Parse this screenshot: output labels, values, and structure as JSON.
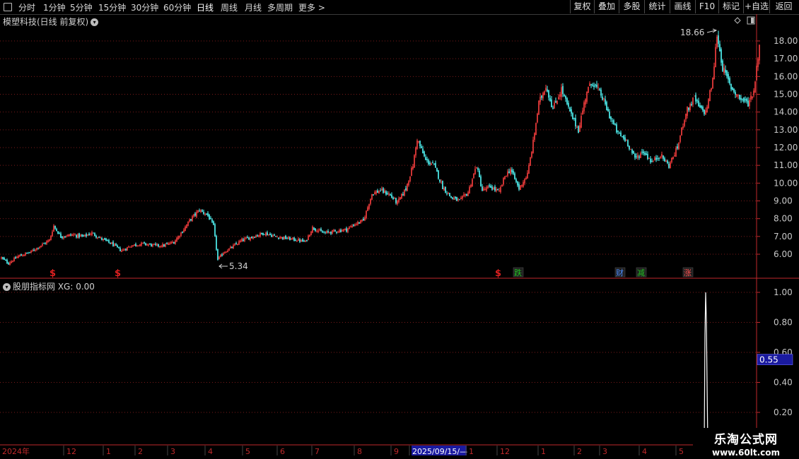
{
  "toolbar": {
    "left_items": [
      "分时",
      "1分钟",
      "5分钟",
      "15分钟",
      "30分钟",
      "60分钟",
      "日线",
      "周线",
      "月线",
      "多周期",
      "更多 >"
    ],
    "active_item": "日线",
    "right_items": [
      "复权",
      "叠加",
      "多股",
      "统计",
      "画线",
      "F10",
      "标记",
      "+自选",
      "返回"
    ]
  },
  "main_panel": {
    "title": "模塑科技(日线 前复权)",
    "high_label": "18.66",
    "low_label": "5.34"
  },
  "sub_panel": {
    "title": "股朋指标网  XG: 0.00",
    "current_value_box": "0.55"
  },
  "markers": [
    {
      "text": "$",
      "color": "#e02020",
      "index": 36
    },
    {
      "text": "$",
      "color": "#e02020",
      "index": 82
    },
    {
      "text": "$",
      "color": "#e02020",
      "index": 351
    },
    {
      "text": "跌",
      "color": "#22c022",
      "index": 365
    },
    {
      "text": "财",
      "color": "#4a8cff",
      "index": 437
    },
    {
      "text": "减",
      "color": "#22c022",
      "index": 452
    },
    {
      "text": "涨",
      "color": "#ff5050",
      "index": 485
    }
  ],
  "time_axis": {
    "labels": [
      "2024年",
      "12",
      "1",
      "2",
      "3",
      "4",
      "5",
      "6",
      "7",
      "8",
      "9",
      "2025/09/15/—",
      "1",
      "12",
      "1",
      "2",
      "3",
      "4",
      "5"
    ]
  },
  "watermark": {
    "title": "乐淘公式网",
    "url": "www.60lt.com"
  },
  "colors": {
    "up": "#ff4040",
    "down": "#54ffff",
    "grid": "#7a1a1a",
    "axis": "#c0292b",
    "text": "#c8c8c8"
  },
  "chart_data": [
    {
      "type": "candlestick",
      "title": "模塑科技(日线 前复权)",
      "ylim": [
        5.0,
        19.0
      ],
      "y_ticks": [
        6.0,
        7.0,
        8.0,
        9.0,
        10.0,
        11.0,
        12.0,
        13.0,
        14.0,
        15.0,
        16.0,
        17.0,
        18.0
      ],
      "annotations": [
        {
          "text": "18.66",
          "kind": "high"
        },
        {
          "text": "5.34",
          "kind": "low"
        }
      ],
      "close_path": [
        [
          0,
          5.8
        ],
        [
          5,
          5.5
        ],
        [
          12,
          5.9
        ],
        [
          20,
          6.1
        ],
        [
          28,
          6.5
        ],
        [
          34,
          6.8
        ],
        [
          37,
          7.6
        ],
        [
          42,
          7.0
        ],
        [
          50,
          7.1
        ],
        [
          58,
          7.0
        ],
        [
          64,
          7.2
        ],
        [
          70,
          6.9
        ],
        [
          78,
          6.6
        ],
        [
          85,
          6.2
        ],
        [
          92,
          6.5
        ],
        [
          100,
          6.6
        ],
        [
          108,
          6.5
        ],
        [
          115,
          6.5
        ],
        [
          122,
          6.7
        ],
        [
          128,
          7.3
        ],
        [
          134,
          8.0
        ],
        [
          140,
          8.5
        ],
        [
          146,
          8.2
        ],
        [
          150,
          7.6
        ],
        [
          153,
          5.7
        ],
        [
          157,
          6.1
        ],
        [
          163,
          6.4
        ],
        [
          170,
          6.8
        ],
        [
          178,
          7.0
        ],
        [
          186,
          7.2
        ],
        [
          194,
          7.0
        ],
        [
          202,
          6.9
        ],
        [
          210,
          6.8
        ],
        [
          215,
          6.7
        ],
        [
          220,
          7.5
        ],
        [
          228,
          7.2
        ],
        [
          236,
          7.3
        ],
        [
          244,
          7.4
        ],
        [
          250,
          7.7
        ],
        [
          256,
          7.9
        ],
        [
          262,
          9.4
        ],
        [
          268,
          9.6
        ],
        [
          274,
          9.4
        ],
        [
          280,
          8.9
        ],
        [
          286,
          9.7
        ],
        [
          291,
          11.0
        ],
        [
          294,
          12.5
        ],
        [
          300,
          11.3
        ],
        [
          306,
          11.0
        ],
        [
          312,
          9.8
        ],
        [
          318,
          9.2
        ],
        [
          324,
          9.0
        ],
        [
          330,
          9.5
        ],
        [
          336,
          11.0
        ],
        [
          340,
          9.6
        ],
        [
          346,
          9.8
        ],
        [
          352,
          9.5
        ],
        [
          356,
          10.4
        ],
        [
          360,
          10.8
        ],
        [
          366,
          9.7
        ],
        [
          372,
          10.5
        ],
        [
          376,
          12.3
        ],
        [
          380,
          14.5
        ],
        [
          385,
          15.5
        ],
        [
          390,
          14.2
        ],
        [
          396,
          15.3
        ],
        [
          402,
          14.0
        ],
        [
          408,
          13.0
        ],
        [
          414,
          15.2
        ],
        [
          418,
          15.7
        ],
        [
          424,
          15.0
        ],
        [
          430,
          13.8
        ],
        [
          436,
          12.8
        ],
        [
          442,
          12.4
        ],
        [
          448,
          11.4
        ],
        [
          454,
          11.8
        ],
        [
          460,
          11.2
        ],
        [
          466,
          11.6
        ],
        [
          472,
          11.0
        ],
        [
          478,
          12.0
        ],
        [
          484,
          14.0
        ],
        [
          490,
          14.8
        ],
        [
          494,
          14.2
        ],
        [
          498,
          14.0
        ],
        [
          503,
          15.8
        ],
        [
          506,
          18.4
        ],
        [
          510,
          16.5
        ],
        [
          516,
          15.4
        ],
        [
          522,
          14.8
        ],
        [
          528,
          14.5
        ],
        [
          532,
          15.2
        ],
        [
          536,
          17.8
        ]
      ],
      "n_bars": 537
    },
    {
      "type": "line",
      "title": "股朋指标网  XG: 0.00",
      "ylim": [
        0.0,
        1.05
      ],
      "y_ticks": [
        0.2,
        0.4,
        0.6,
        0.8,
        1.0
      ],
      "current_value": 0.55,
      "series": [
        {
          "name": "XG",
          "spike_index": 498,
          "spike_value": 1.0
        }
      ]
    }
  ]
}
